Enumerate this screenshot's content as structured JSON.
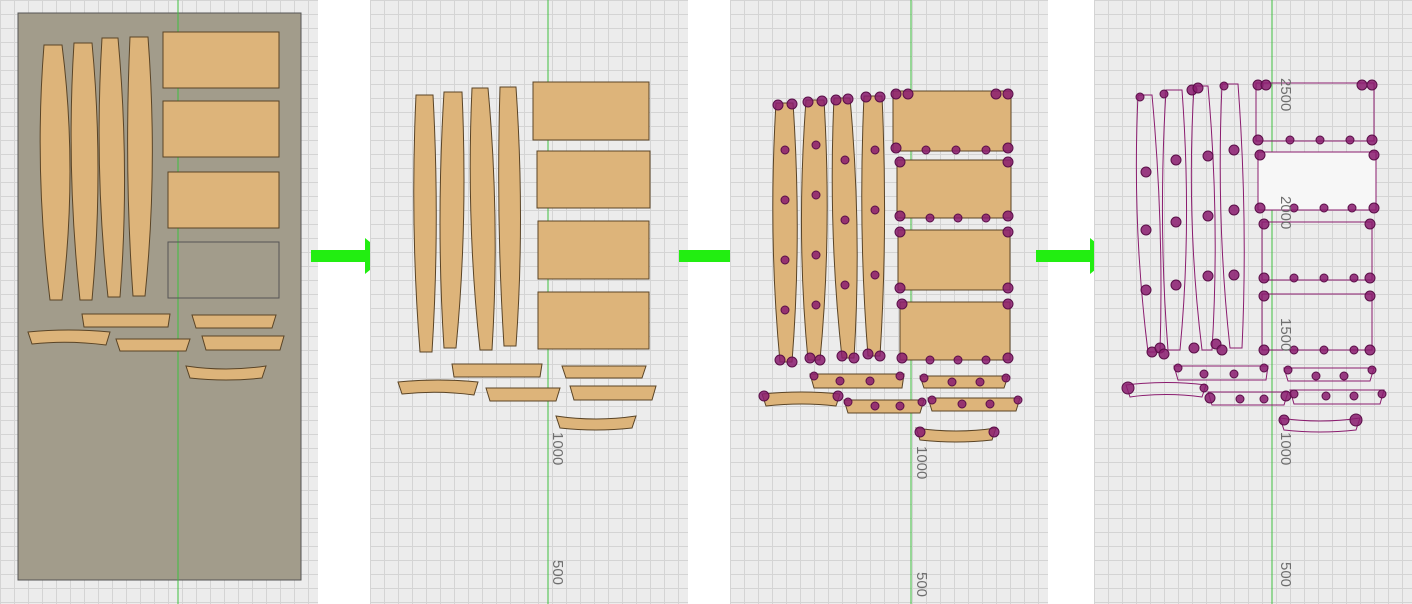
{
  "panels": [
    {
      "id": "panel-1",
      "labels": []
    },
    {
      "id": "panel-2",
      "labels": [
        {
          "text": "1000"
        },
        {
          "text": "500"
        }
      ]
    },
    {
      "id": "panel-3",
      "labels": [
        {
          "text": "1000"
        },
        {
          "text": "500"
        }
      ]
    },
    {
      "id": "panel-4",
      "labels": [
        {
          "text": "2500"
        },
        {
          "text": "2000"
        },
        {
          "text": "1500"
        },
        {
          "text": "1000"
        },
        {
          "text": "500"
        }
      ]
    }
  ],
  "colors": {
    "grid_background": "#ececec",
    "grid_line": "#d4d4d4",
    "axis_line": "#3fbf3f",
    "stock_sheet": "#a29c8b",
    "wood_part": "#ddb47a",
    "node_marker": "#8a1b6e",
    "arrow": "#22ee11"
  },
  "icons": [
    "right-arrow-icon",
    "right-arrow-icon",
    "right-arrow-icon"
  ]
}
